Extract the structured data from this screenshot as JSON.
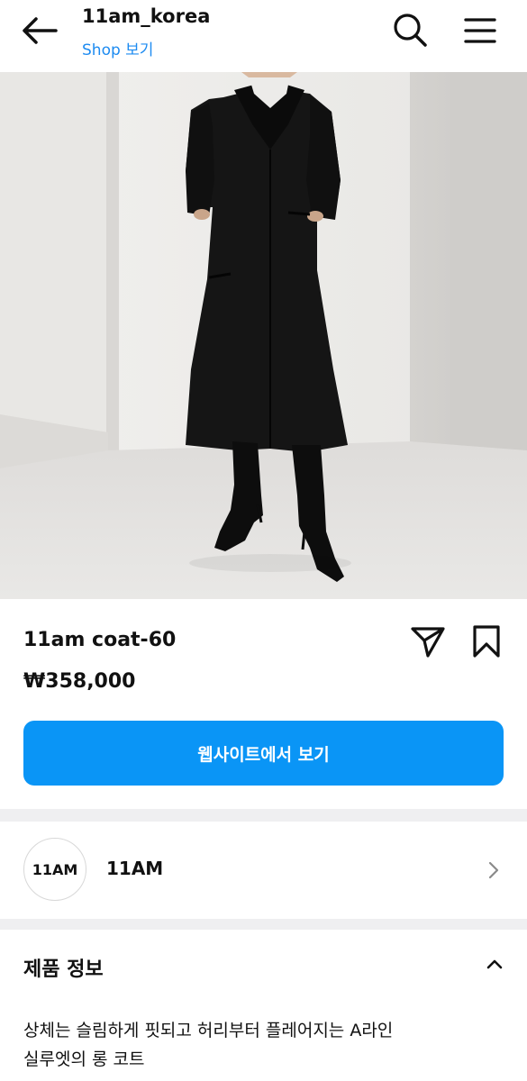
{
  "header": {
    "title": "11am_korea",
    "subtitle": "Shop 보기",
    "icons": [
      "back-arrow-icon",
      "search-icon",
      "menu-icon"
    ]
  },
  "product": {
    "image_alt": "model wearing long black A-line coat with black knee-high boots",
    "name": "11am coat-60",
    "price": "₩358,000",
    "icons": [
      "share-icon",
      "bookmark-icon"
    ]
  },
  "cta": {
    "label": "웹사이트에서 보기"
  },
  "merchant": {
    "avatar_text": "11AM",
    "name": "11AM",
    "icon": "chevron-right-icon"
  },
  "info": {
    "title": "제품 정보",
    "icon": "chevron-up-icon",
    "description_line1": "상체는 슬림하게 핏되고 허리부터 플레어지는 A라인",
    "description_line2": "실루엣의 롱 코트"
  },
  "colors": {
    "accent": "#1d8bf1",
    "button": "#0a95f6",
    "divider": "#efeff1"
  }
}
